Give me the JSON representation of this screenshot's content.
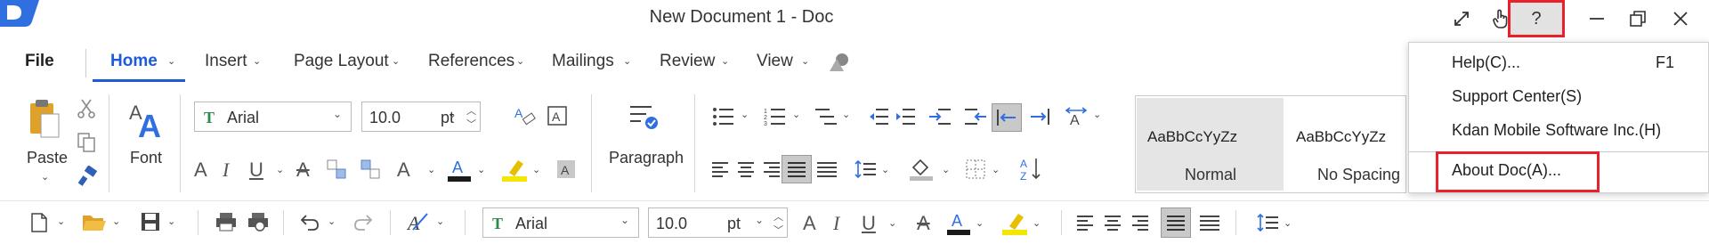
{
  "app": {
    "title": "New Document 1 - Doc"
  },
  "titlebar": {
    "expand_icon": "expand-icon",
    "touch_icon": "hand-pointer-icon",
    "help_label": "?",
    "minimize_label": "—",
    "close_label": "✕"
  },
  "tabs": {
    "file": "File",
    "home": "Home",
    "insert": "Insert",
    "page_layout": "Page Layout",
    "references": "References",
    "mailings": "Mailings",
    "review": "Review",
    "view": "View"
  },
  "ribbon": {
    "paste_label": "Paste",
    "font_label": "Font",
    "font_name": "Arial",
    "font_size": "10.0",
    "font_unit": "pt",
    "paragraph_label": "Paragraph"
  },
  "styles": {
    "normal_sample": "AaBbCcYyZz",
    "normal_label": "Normal",
    "nospacing_sample": "AaBbCcYyZz",
    "nospacing_label": "No Spacing"
  },
  "help_menu": {
    "items": [
      {
        "label": "Help(C)...",
        "shortcut": "F1"
      },
      {
        "label": "Support Center(S)",
        "shortcut": ""
      },
      {
        "label": "Kdan Mobile Software Inc.(H)",
        "shortcut": ""
      },
      {
        "label": "About Doc(A)...",
        "shortcut": ""
      }
    ]
  },
  "quickbar": {
    "font_name": "Arial",
    "font_size": "10.0",
    "font_unit": "pt"
  },
  "colors": {
    "accent": "#1e5bd8",
    "highlight_box": "#e8212b",
    "font_color_bar": "#1a1a1a",
    "highlight_bar": "#f3e600",
    "app_icon": "#2f6fe0"
  }
}
